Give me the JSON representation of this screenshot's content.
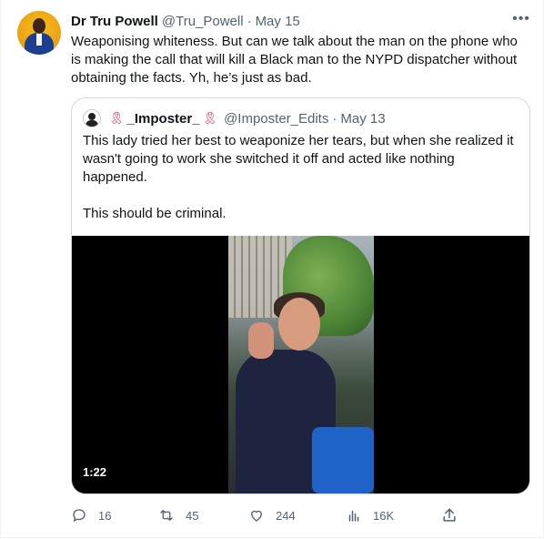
{
  "tweet": {
    "author_name": "Dr Tru Powell",
    "author_handle": "@Tru_Powell",
    "separator": "·",
    "date": "May 15",
    "text": "Weaponising whiteness. But can we talk about the man on the phone who is making the call that will kill a Black man to the NYPD dispatcher without obtaining the facts. Yh, he’s just as bad.",
    "more_icon": "more-horizontal-icon"
  },
  "quote": {
    "author_name": "_Imposter_",
    "ribbon": "🎗",
    "author_handle": "@Imposter_Edits",
    "separator": "·",
    "date": "May 13",
    "text_p1": "This lady tried her best to weaponize her tears, but when she realized it wasn't going to work she switched it off and acted like nothing happened.",
    "text_p2": "This should be criminal.",
    "video_duration": "1:22"
  },
  "actions": {
    "reply_count": "16",
    "retweet_count": "45",
    "like_count": "244",
    "views_count": "16K",
    "colors": {
      "icon": "#536471"
    }
  }
}
